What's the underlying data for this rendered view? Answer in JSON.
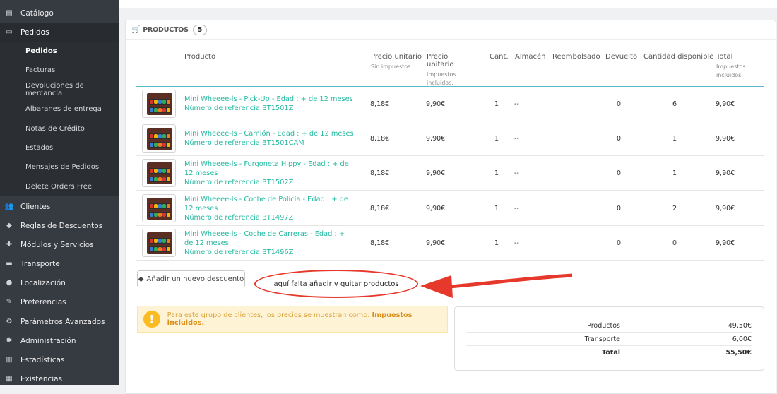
{
  "sidebar": {
    "items": [
      {
        "label": "Catálogo",
        "icon": "book-icon",
        "glyph": "▤"
      },
      {
        "label": "Pedidos",
        "icon": "credit-card-icon",
        "glyph": "▭",
        "active": true
      },
      {
        "label": "Clientes",
        "icon": "users-icon",
        "glyph": "👥"
      },
      {
        "label": "Reglas de Descuentos",
        "icon": "tag-icon",
        "glyph": "◆"
      },
      {
        "label": "Módulos y Servicios",
        "icon": "puzzle-icon",
        "glyph": "✚"
      },
      {
        "label": "Transporte",
        "icon": "truck-icon",
        "glyph": "▬"
      },
      {
        "label": "Localización",
        "icon": "globe-icon",
        "glyph": "●"
      },
      {
        "label": "Preferencias",
        "icon": "wrench-icon",
        "glyph": "✎"
      },
      {
        "label": "Parámetros Avanzados",
        "icon": "cogs-icon",
        "glyph": "⚙"
      },
      {
        "label": "Administración",
        "icon": "gear-icon",
        "glyph": "✱"
      },
      {
        "label": "Estadísticas",
        "icon": "bar-chart-icon",
        "glyph": "▥"
      },
      {
        "label": "Existencias",
        "icon": "archive-icon",
        "glyph": "▦"
      }
    ],
    "subitems": [
      {
        "label": "Pedidos",
        "active": true
      },
      {
        "label": "Facturas"
      },
      {
        "label": "Devoluciones de mercancía"
      },
      {
        "label": "Albaranes de entrega"
      },
      {
        "label": "Notas de Crédito"
      },
      {
        "label": "Estados"
      },
      {
        "label": "Mensajes de Pedidos"
      },
      {
        "label": "Delete Orders Free"
      }
    ]
  },
  "panel": {
    "title": "PRODUCTOS",
    "count": "5",
    "headers": {
      "product": "Producto",
      "unit_price": "Precio unitario",
      "unit_price_sub": "Sin impuestos.",
      "unit_price_tax": "Precio unitario",
      "unit_price_tax_sub": "Impuestos incluidos.",
      "qty": "Cant.",
      "warehouse": "Almacén",
      "refund": "Reembolsado",
      "returned": "Devuelto",
      "available": "Cantidad disponible",
      "total": "Total",
      "total_sub": "Impuestos incluidos."
    },
    "rows": [
      {
        "name": "Mini Wheeee-ls - Pick-Up - Edad : + de 12 meses",
        "ref": "Número de referencia BT1501Z",
        "price": "8,18€",
        "price_tax": "9,90€",
        "qty": "1",
        "warehouse": "--",
        "returned": "0",
        "available": "6",
        "total": "9,90€"
      },
      {
        "name": "Mini Wheeee-ls - Camión - Edad : + de 12 meses",
        "ref": "Número de referencia BT1501CAM",
        "price": "8,18€",
        "price_tax": "9,90€",
        "qty": "1",
        "warehouse": "--",
        "returned": "0",
        "available": "1",
        "total": "9,90€"
      },
      {
        "name": "Mini Wheeee-ls - Furgoneta Hippy - Edad : + de 12 meses",
        "ref": "Número de referencia BT1502Z",
        "price": "8,18€",
        "price_tax": "9,90€",
        "qty": "1",
        "warehouse": "--",
        "returned": "0",
        "available": "1",
        "total": "9,90€"
      },
      {
        "name": "Mini Wheeee-ls - Coche de Policía - Edad : + de 12 meses",
        "ref": "Número de referencia BT1497Z",
        "price": "8,18€",
        "price_tax": "9,90€",
        "qty": "1",
        "warehouse": "--",
        "returned": "0",
        "available": "2",
        "total": "9,90€"
      },
      {
        "name": "Mini Wheeee-ls - Coche de Carreras - Edad : + de 12 meses",
        "ref": "Número de referencia BT1496Z",
        "price": "8,18€",
        "price_tax": "9,90€",
        "qty": "1",
        "warehouse": "--",
        "returned": "0",
        "available": "0",
        "total": "9,90€"
      }
    ],
    "discount_button": "Añadir un nuevo descuento",
    "annotation": "aquí falta añadir y quitar productos",
    "alert": {
      "text": "Para este grupo de clientes, los precios se muestran como: ",
      "strong": "Impuestos incluidos."
    },
    "totals": [
      {
        "label": "Productos",
        "value": "49,50€"
      },
      {
        "label": "Transporte",
        "value": "6,00€"
      },
      {
        "label": "Total",
        "value": "55,50€"
      }
    ]
  },
  "colors": {
    "sidebar_bg": "#363a41",
    "accent_teal": "#25b9a1",
    "annotation_red": "#e6382b",
    "alert_bg": "#fff3d6"
  }
}
